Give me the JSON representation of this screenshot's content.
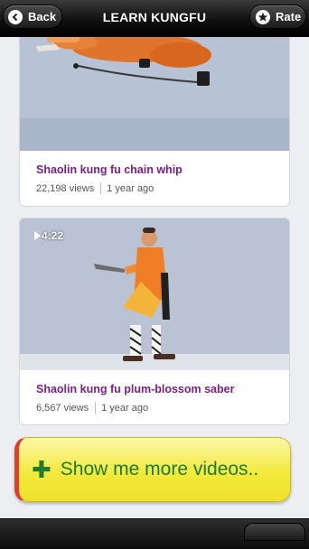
{
  "header": {
    "back_label": "Back",
    "title": "LEARN KUNGFU",
    "rate_label": "Rate",
    "back_icon": "chevron-left-icon",
    "rate_icon": "star-icon"
  },
  "videos": [
    {
      "title": "Shaolin kung fu chain whip",
      "views": "22,198 views",
      "age": "1 year ago",
      "duration": ""
    },
    {
      "title": "Shaolin kung fu plum-blossom saber",
      "views": "6,567 views",
      "age": "1 year ago",
      "duration": "4:22"
    }
  ],
  "more_button": {
    "label": "Show me more videos..",
    "icon": "plus-icon"
  },
  "colors": {
    "title_purple": "#7b1f82",
    "more_bg": "#f3ea3d",
    "more_text": "#1f7a34",
    "accent_red": "#d9402e"
  }
}
